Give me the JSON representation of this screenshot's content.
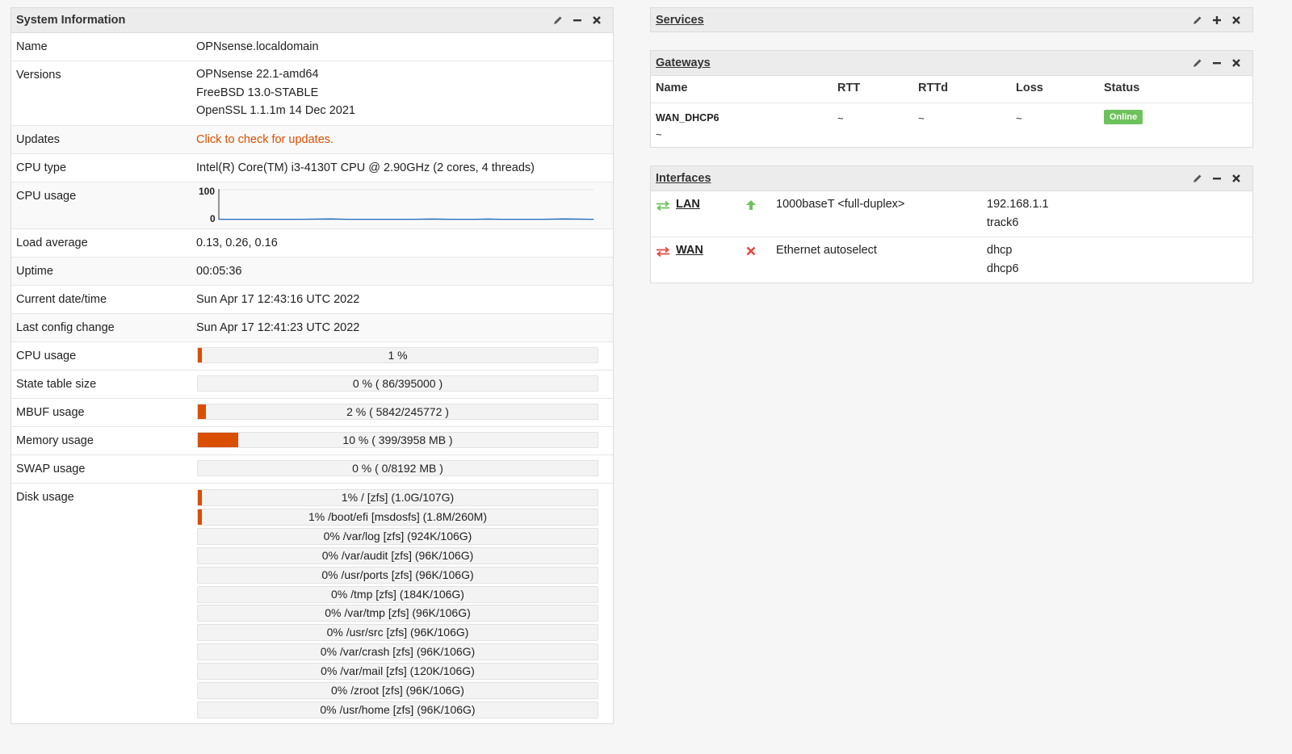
{
  "system_info": {
    "title": "System Information",
    "name_label": "Name",
    "name_value": "OPNsense.localdomain",
    "versions_label": "Versions",
    "versions": [
      "OPNsense 22.1-amd64",
      "FreeBSD 13.0-STABLE",
      "OpenSSL 1.1.1m 14 Dec 2021"
    ],
    "updates_label": "Updates",
    "updates_link": "Click to check for updates.",
    "cpu_type_label": "CPU type",
    "cpu_type_value": "Intel(R) Core(TM) i3-4130T CPU @ 2.90GHz (2 cores, 4 threads)",
    "cpu_usage_label": "CPU usage",
    "cpu_graph": {
      "y_max_label": "100",
      "y_min_label": "0",
      "color": "#1f6fbf"
    },
    "load_label": "Load average",
    "load_value": "0.13, 0.26, 0.16",
    "uptime_label": "Uptime",
    "uptime_value": "00:05:36",
    "datetime_label": "Current date/time",
    "datetime_value": "Sun Apr 17 12:43:16 UTC 2022",
    "lastconfig_label": "Last config change",
    "lastconfig_value": "Sun Apr 17 12:41:23 UTC 2022",
    "cpu_usage2_label": "CPU usage",
    "cpu_usage2_text": "1 %",
    "cpu_usage2_pct": 1,
    "state_label": "State table size",
    "state_text": "0 % ( 86/395000 )",
    "state_pct": 0,
    "mbuf_label": "MBUF usage",
    "mbuf_text": "2 % ( 5842/245772 )",
    "mbuf_pct": 2,
    "memory_label": "Memory usage",
    "memory_text": "10 % ( 399/3958 MB )",
    "memory_pct": 10,
    "swap_label": "SWAP usage",
    "swap_text": "0 % ( 0/8192 MB )",
    "swap_pct": 0,
    "disk_label": "Disk usage",
    "disks": [
      {
        "text": "1% / [zfs] (1.0G/107G)",
        "pct": 1
      },
      {
        "text": "1% /boot/efi [msdosfs] (1.8M/260M)",
        "pct": 1
      },
      {
        "text": "0% /var/log [zfs] (924K/106G)",
        "pct": 0
      },
      {
        "text": "0% /var/audit [zfs] (96K/106G)",
        "pct": 0
      },
      {
        "text": "0% /usr/ports [zfs] (96K/106G)",
        "pct": 0
      },
      {
        "text": "0% /tmp [zfs] (184K/106G)",
        "pct": 0
      },
      {
        "text": "0% /var/tmp [zfs] (96K/106G)",
        "pct": 0
      },
      {
        "text": "0% /usr/src [zfs] (96K/106G)",
        "pct": 0
      },
      {
        "text": "0% /var/crash [zfs] (96K/106G)",
        "pct": 0
      },
      {
        "text": "0% /var/mail [zfs] (120K/106G)",
        "pct": 0
      },
      {
        "text": "0% /zroot [zfs] (96K/106G)",
        "pct": 0
      },
      {
        "text": "0% /usr/home [zfs] (96K/106G)",
        "pct": 0
      }
    ]
  },
  "services": {
    "title": "Services"
  },
  "gateways": {
    "title": "Gateways",
    "columns": [
      "Name",
      "RTT",
      "RTTd",
      "Loss",
      "Status"
    ],
    "rows": [
      {
        "name": "WAN_DHCP6",
        "sub": "~",
        "rtt": "~",
        "rttd": "~",
        "loss": "~",
        "status": "Online"
      }
    ],
    "online_color": "#6ec25c"
  },
  "interfaces": {
    "title": "Interfaces",
    "rows": [
      {
        "name": "LAN",
        "media": "1000baseT <full-duplex>",
        "addr1": "192.168.1.1",
        "addr2": "track6",
        "state": "up",
        "icon": "interface-arrows-icon",
        "status_icon": "arrow-up-icon"
      },
      {
        "name": "WAN",
        "media": "Ethernet autoselect",
        "addr1": "dhcp",
        "addr2": "dhcp6",
        "state": "down",
        "icon": "interface-arrows-icon",
        "status_icon": "x-mark-icon"
      }
    ]
  },
  "colors": {
    "accent": "#d94f00",
    "up": "#6ec25c",
    "down": "#e04a3f"
  }
}
